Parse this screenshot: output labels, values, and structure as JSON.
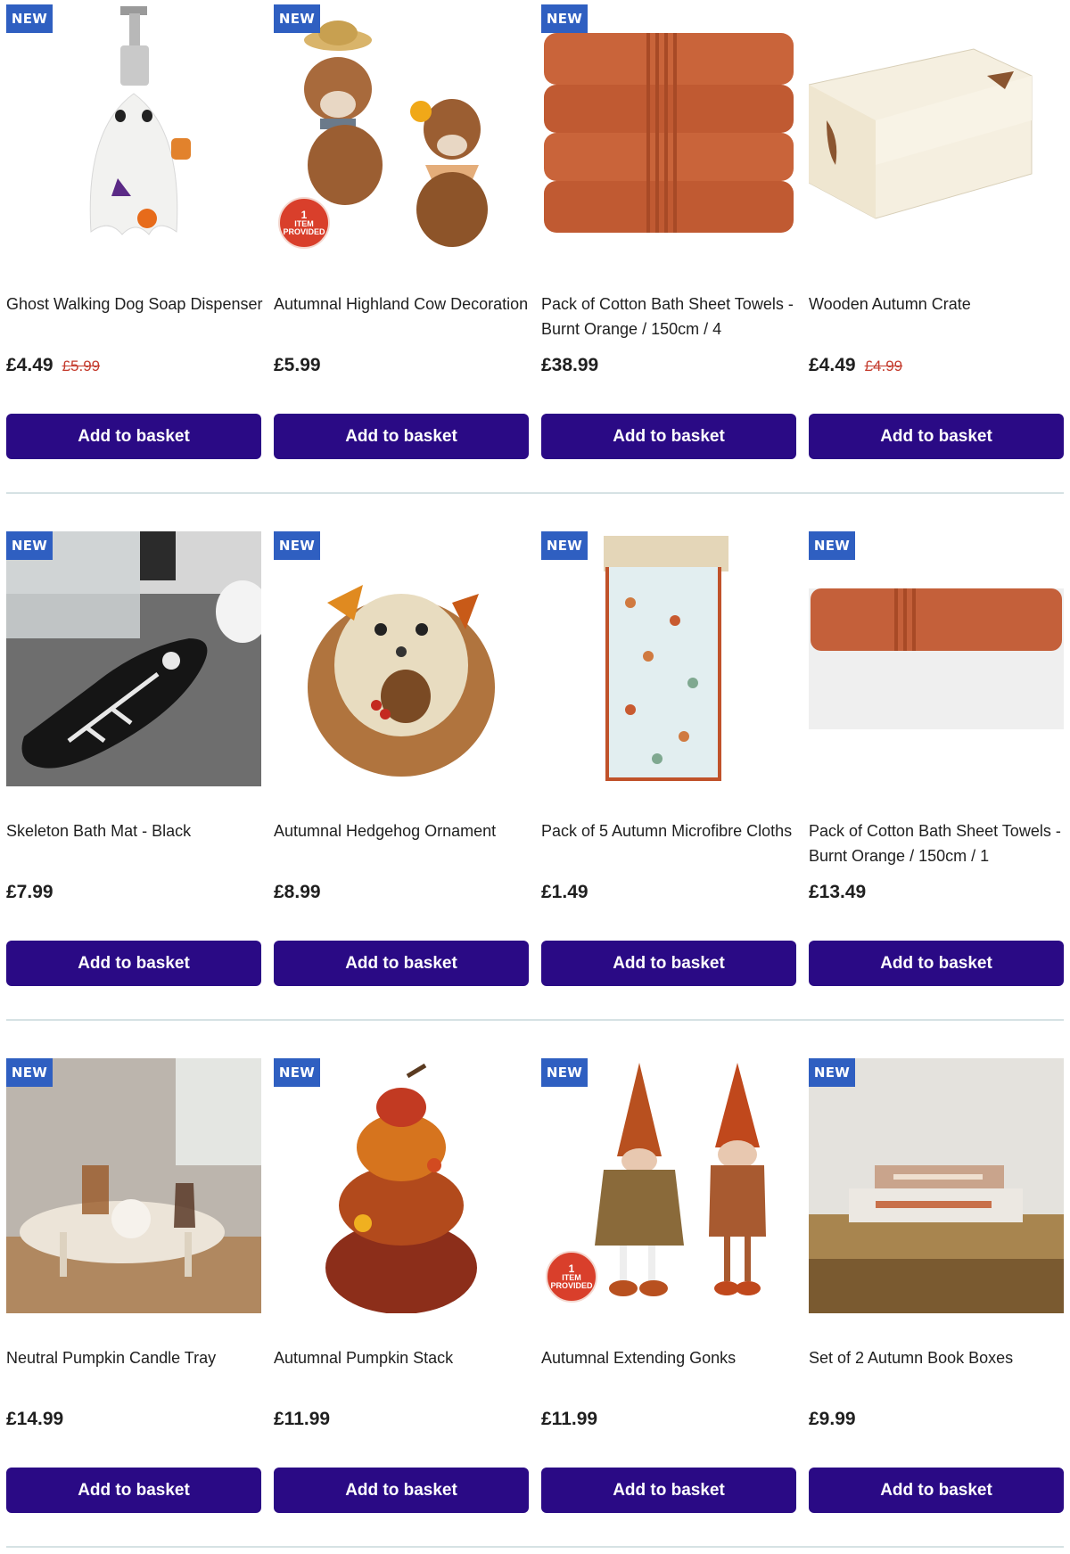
{
  "labels": {
    "new_badge": "NEW",
    "add_to_basket": "Add to basket",
    "item_provided_num": "1",
    "item_provided_text": "ITEM PROVIDED"
  },
  "products": [
    {
      "title": "Ghost Walking Dog Soap Dispenser",
      "price": "£4.49",
      "was_price": "£5.99",
      "image": "ghost-soap-dispenser"
    },
    {
      "title": "Autumnal Highland Cow Decoration",
      "price": "£5.99",
      "was_price": "",
      "image": "highland-cow",
      "item_provided": true
    },
    {
      "title": "Pack of Cotton Bath Sheet Towels - Burnt Orange / 150cm / 4",
      "price": "£38.99",
      "was_price": "",
      "image": "towel-stack"
    },
    {
      "title": "Wooden Autumn Crate",
      "price": "£4.49",
      "was_price": "£4.99",
      "image": "wooden-crate",
      "no_badge": true
    },
    {
      "title": "Skeleton Bath Mat - Black",
      "price": "£7.99",
      "was_price": "",
      "image": "skeleton-bath-mat"
    },
    {
      "title": "Autumnal Hedgehog Ornament",
      "price": "£8.99",
      "was_price": "",
      "image": "hedgehog-ornament"
    },
    {
      "title": "Pack of 5 Autumn Microfibre Cloths",
      "price": "£1.49",
      "was_price": "",
      "image": "microfibre-cloths"
    },
    {
      "title": "Pack of Cotton Bath Sheet Towels - Burnt Orange / 150cm / 1",
      "price": "£13.49",
      "was_price": "",
      "image": "single-towel"
    },
    {
      "title": "Neutral Pumpkin Candle Tray",
      "price": "£14.99",
      "was_price": "",
      "image": "candle-tray"
    },
    {
      "title": "Autumnal Pumpkin Stack",
      "price": "£11.99",
      "was_price": "",
      "image": "pumpkin-stack"
    },
    {
      "title": "Autumnal Extending Gonks",
      "price": "£11.99",
      "was_price": "",
      "image": "gonks",
      "item_provided": true
    },
    {
      "title": "Set of 2 Autumn Book Boxes",
      "price": "£9.99",
      "was_price": "",
      "image": "book-boxes"
    }
  ],
  "colors": {
    "badge": "#2f5fc1",
    "button": "#2a0a85",
    "sale": "#c43b2d",
    "divider": "#d6e2e4"
  }
}
